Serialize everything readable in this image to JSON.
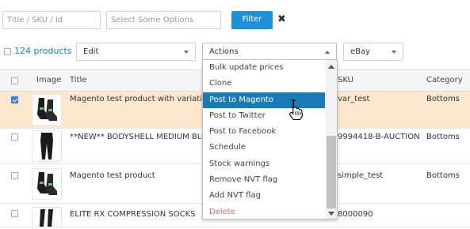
{
  "filters": {
    "search_placeholder": "Title / SKU / Id",
    "options_placeholder": "Select Some Options",
    "filter_label": "Filter",
    "clear_symbol": "✖"
  },
  "toolbar": {
    "products_count": "124 products",
    "edit_label": "Edit",
    "actions_label": "Actions",
    "channel_label": "eBay"
  },
  "table": {
    "columns": [
      "Image",
      "Title",
      "SKU",
      "Category"
    ],
    "rows": [
      {
        "title": "Magento test product with variations",
        "sku": "var_test",
        "category": "Bottoms",
        "checked": true,
        "thumb": "socks"
      },
      {
        "title": "**NEW** BODYSHELL MEDIUM BLUE LEGGINGS",
        "sku": "9994418-B-AUCTION",
        "category": "Bottoms",
        "checked": false,
        "thumb": "leggings"
      },
      {
        "title": "Magento test product",
        "sku": "simple_test",
        "category": "Bottoms",
        "checked": false,
        "thumb": "socks"
      },
      {
        "title": "ELITE RX COMPRESSION SOCKS",
        "sku": "8000090",
        "category": "",
        "checked": false,
        "thumb": "compression-socks"
      }
    ]
  },
  "actions_menu": {
    "items": [
      {
        "label": "Bulk update prices",
        "state": "normal"
      },
      {
        "label": "Clone",
        "state": "normal"
      },
      {
        "label": "Post to Magento",
        "state": "active"
      },
      {
        "label": "Post to Twitter",
        "state": "normal"
      },
      {
        "label": "Post to Facebook",
        "state": "normal"
      },
      {
        "label": "Schedule",
        "state": "normal"
      },
      {
        "label": "Stock warnings",
        "state": "normal"
      },
      {
        "label": "Remove NVT flag",
        "state": "normal"
      },
      {
        "label": "Add NVT flag",
        "state": "normal"
      },
      {
        "label": "Delete",
        "state": "danger"
      }
    ]
  },
  "colors": {
    "primary": "#1f8fd6",
    "highlight_row": "#fde8cf",
    "menu_active": "#1a7ab8",
    "danger": "#e26a6a",
    "link": "#1a7ab8"
  }
}
